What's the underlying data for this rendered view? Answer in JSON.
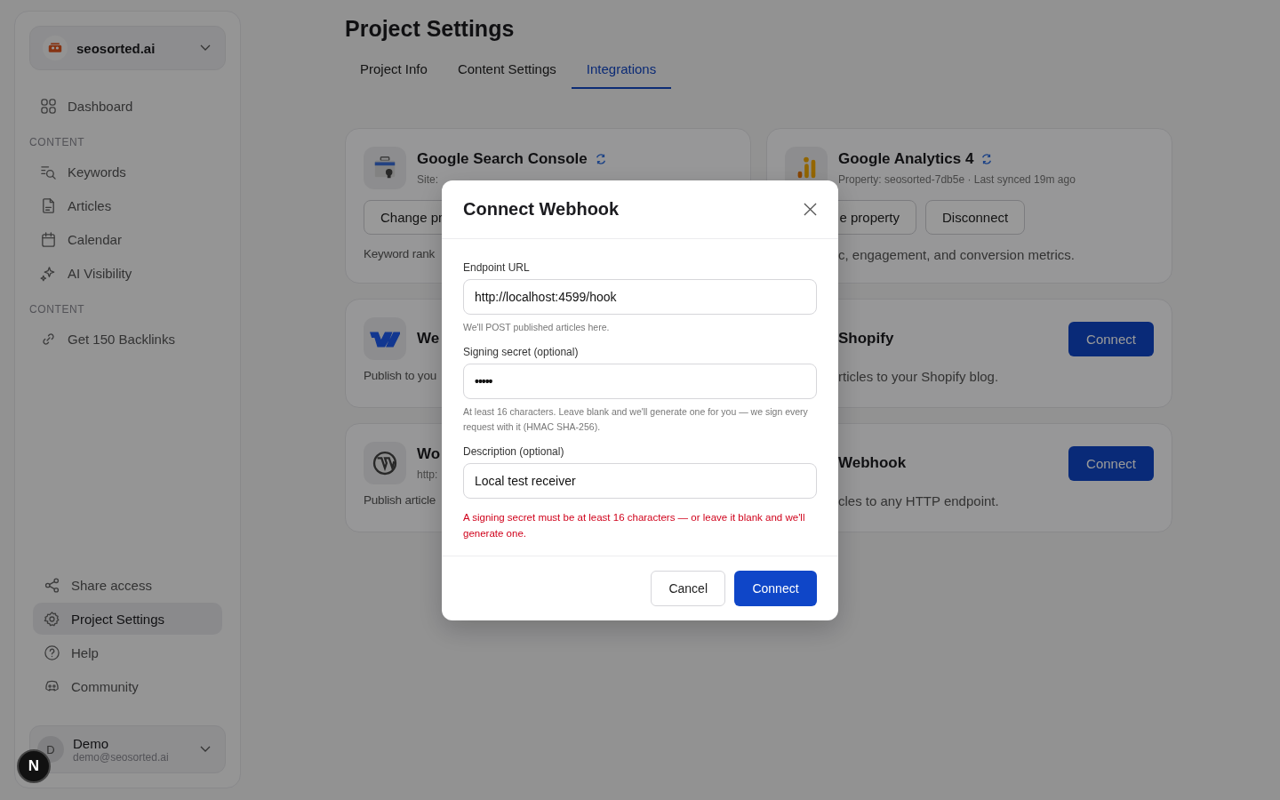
{
  "sidebar": {
    "project": {
      "name": "seosorted.ai"
    },
    "top_items": [
      {
        "label": "Dashboard",
        "selected": false
      }
    ],
    "sections": [
      {
        "heading": "CONTENT",
        "items": [
          {
            "label": "Keywords",
            "selected": false
          },
          {
            "label": "Articles",
            "selected": false
          },
          {
            "label": "Calendar",
            "selected": false
          },
          {
            "label": "AI Visibility",
            "selected": false
          }
        ]
      },
      {
        "heading": "CONTENT",
        "items": [
          {
            "label": "Get 150 Backlinks",
            "selected": false
          }
        ]
      }
    ],
    "bottom_items": [
      {
        "label": "Share access",
        "selected": false
      },
      {
        "label": "Project Settings",
        "selected": true
      },
      {
        "label": "Help",
        "selected": false
      },
      {
        "label": "Community",
        "selected": false
      }
    ],
    "user": {
      "initial": "D",
      "name": "Demo",
      "email": "demo@seosorted.ai"
    }
  },
  "page": {
    "title": "Project Settings",
    "tabs": [
      {
        "label": "Project Info",
        "selected": false
      },
      {
        "label": "Content Settings",
        "selected": false
      },
      {
        "label": "Integrations",
        "selected": true
      }
    ]
  },
  "cards": [
    {
      "title": "Google Search Console",
      "sync": true,
      "subtitle": "Site:",
      "buttons": [
        "Change pr"
      ],
      "description": "Keyword rank"
    },
    {
      "title": "Google Analytics 4",
      "sync": true,
      "subtitle": "Property: seosorted-7db5e · Last synced 19m ago",
      "buttons": [
        "e property",
        "Disconnect"
      ],
      "description": "c, engagement, and conversion metrics."
    },
    {
      "title": "We",
      "description": "Publish to you"
    },
    {
      "title": "Shopify",
      "sync": false,
      "connect": "Connect",
      "description": "rticles to your Shopify blog."
    },
    {
      "title": "Wo",
      "subtitle": "http:",
      "description": "Publish article"
    },
    {
      "title": "Webhook",
      "sync": false,
      "connect": "Connect",
      "description": "cles to any HTTP endpoint."
    }
  ],
  "dialog": {
    "title": "Connect Webhook",
    "fields": [
      {
        "label": "Endpoint URL",
        "value": "http://localhost:4599/hook",
        "hint": "We'll POST published articles here.",
        "kind": "text"
      },
      {
        "label": "Signing secret (optional)",
        "value": "•••••",
        "hint": "At least 16 characters. Leave blank and we'll generate one for you — we sign every request with it (HMAC SHA-256).",
        "kind": "secret"
      },
      {
        "label": "Description (optional)",
        "value": "Local test receiver",
        "kind": "text"
      }
    ],
    "error": "A signing secret must be at least 16 characters — or leave it blank and we'll generate one.",
    "buttons": [
      {
        "label": "Cancel",
        "kind": "secondary"
      },
      {
        "label": "Connect",
        "kind": "primary"
      }
    ]
  },
  "dev_badge": "N"
}
